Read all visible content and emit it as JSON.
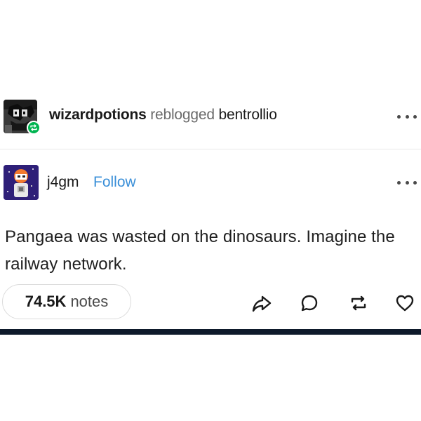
{
  "reblog": {
    "reblogger": "wizardpotions",
    "verb": "reblogged",
    "original": "bentrollio"
  },
  "post": {
    "author": "j4gm",
    "follow_label": "Follow",
    "body": "Pangaea was wasted on the dinosaurs. Imagine the railway network."
  },
  "footer": {
    "notes_count": "74.5K",
    "notes_word": "notes"
  },
  "icons": {
    "share": "share-icon",
    "reply": "reply-icon",
    "reblog": "reblog-icon",
    "like": "heart-icon",
    "more": "more-options-icon"
  },
  "colors": {
    "follow": "#3a8fd8",
    "reblog_badge": "#00b450",
    "bottom_bar": "#0e1a2b"
  }
}
